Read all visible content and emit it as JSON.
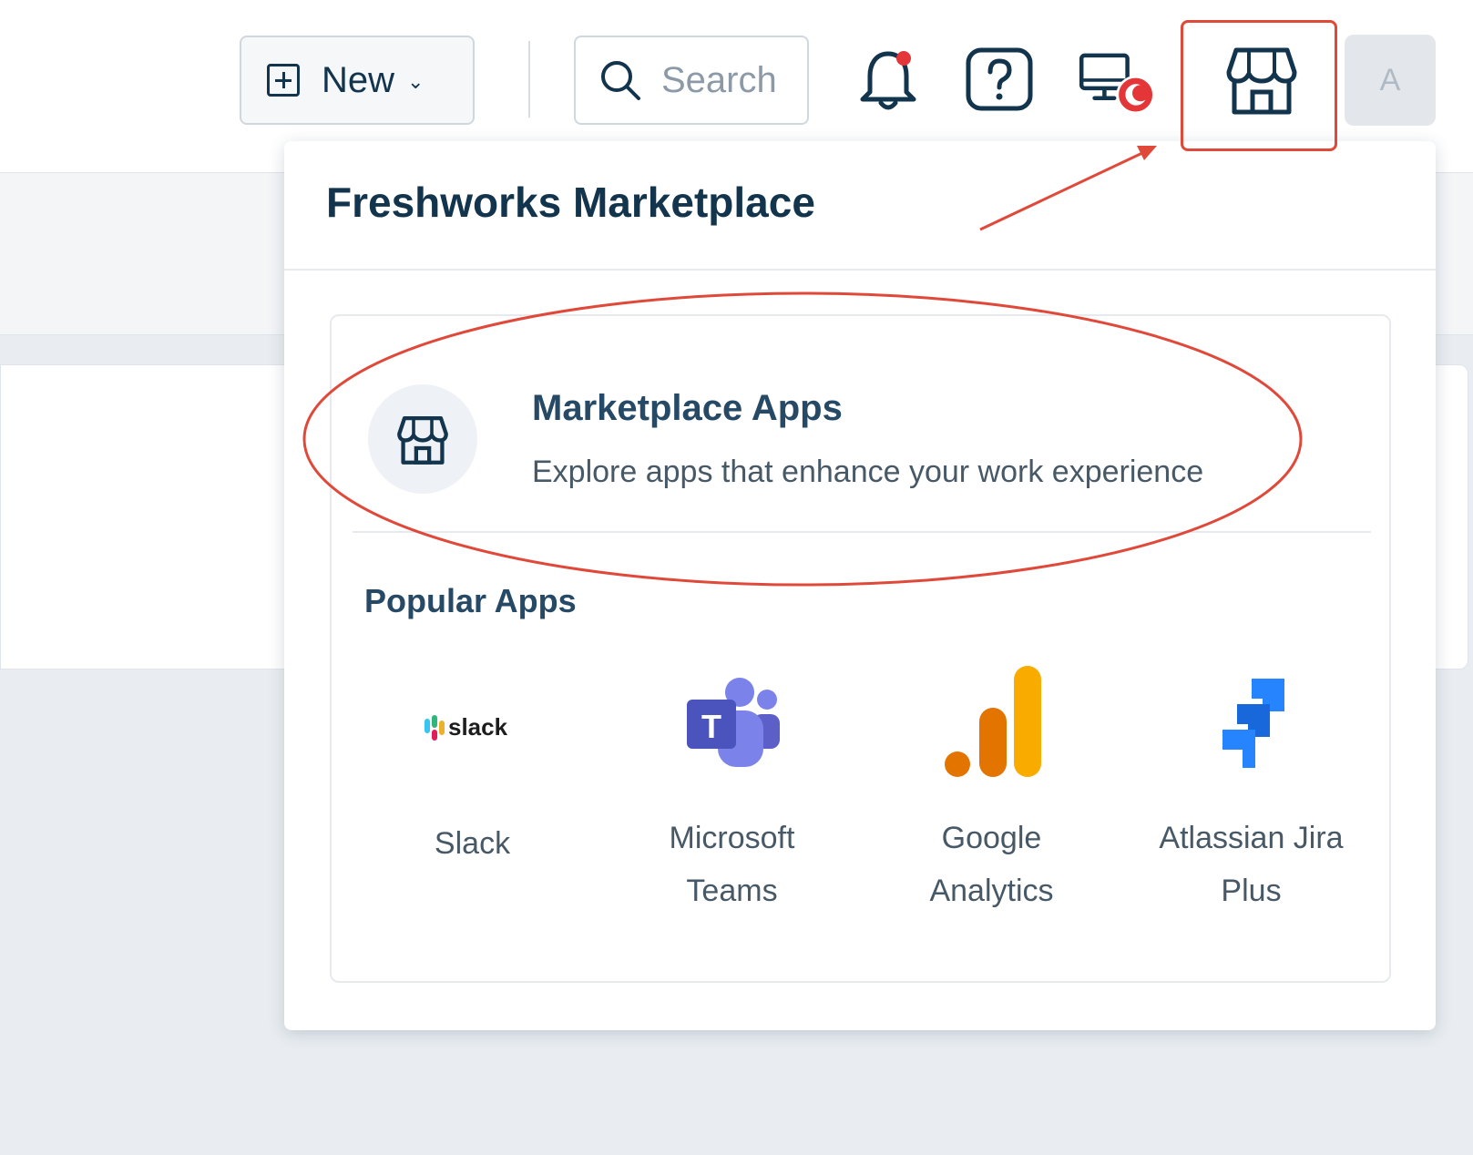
{
  "header": {
    "new_button_label": "New",
    "search_placeholder": "Search",
    "avatar_text": "A"
  },
  "icons": {
    "new_button": "plus-square-icon",
    "new_dropdown": "chevron-down-icon",
    "search": "search-icon",
    "notifications": "bell-icon",
    "help": "question-icon",
    "presence": "monitor-status-icon",
    "marketplace": "storefront-icon"
  },
  "colors": {
    "text_primary": "#12344d",
    "notification_dot": "#e43538",
    "annotation": "#e0493a",
    "slack_text": "#1d1d1d",
    "teams": "#5b5fc7",
    "analytics_orange": "#e37400",
    "analytics_yellow": "#f9ab00",
    "jira_blue": "#2684ff"
  },
  "popup": {
    "title": "Freshworks Marketplace",
    "marketplace_apps": {
      "title": "Marketplace Apps",
      "subtitle": "Explore apps that enhance your work experience"
    },
    "popular_title": "Popular Apps",
    "apps": [
      {
        "name": "Slack",
        "logo_text": "slack"
      },
      {
        "name": "Microsoft Teams",
        "logo_text": "T"
      },
      {
        "name": "Google Analytics"
      },
      {
        "name": "Atlassian Jira Plus"
      }
    ]
  }
}
